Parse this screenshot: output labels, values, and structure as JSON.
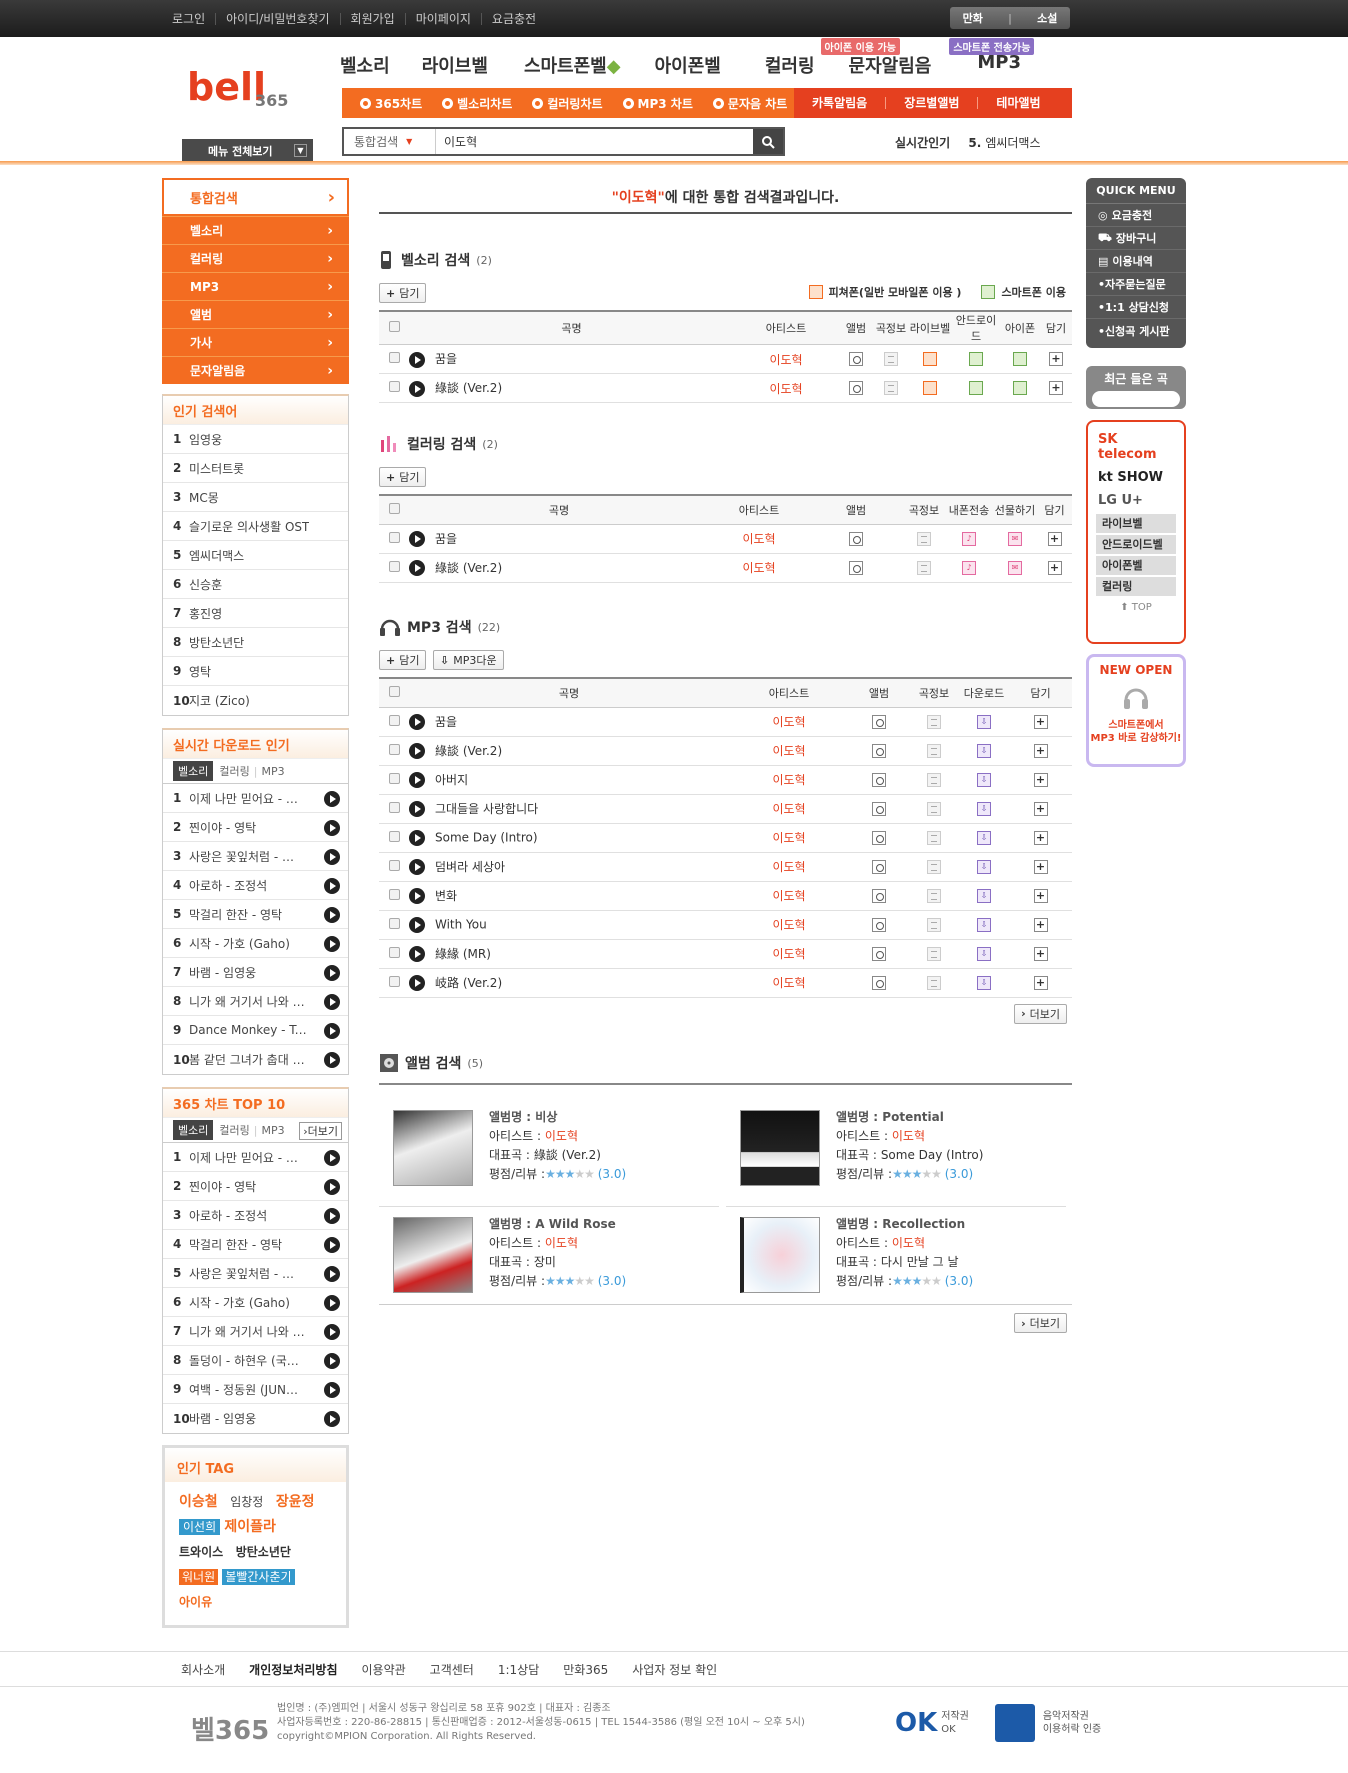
{
  "util": {
    "links": [
      "로그인",
      "아이디/비밀번호찾기",
      "회원가입",
      "마이페이지",
      "요금충전"
    ],
    "toggle": [
      "만화",
      "소설"
    ]
  },
  "nav": {
    "items": [
      "벨소리",
      "라이브벨",
      "스마트폰벨",
      "아이폰벨",
      "컬러링",
      "문자알림음",
      "MP3"
    ],
    "badge_sms": "아이폰 이용 가능",
    "badge_mp3": "스마트폰 전송가능"
  },
  "subnav": {
    "charts": [
      "365차트",
      "벨소리차트",
      "컬러링차트",
      "MP3 차트",
      "문자음 차트"
    ],
    "extra": [
      "카톡알림음",
      "장르별앨범",
      "테마앨범"
    ]
  },
  "menu_all": "메뉴 전체보기",
  "search": {
    "category": "통합검색",
    "query": "이도혁"
  },
  "realtime": {
    "label": "실시간인기",
    "rank": "5.",
    "item": "엠씨더맥스"
  },
  "leftnav": {
    "head": "통합검색",
    "items": [
      "벨소리",
      "컬러링",
      "MP3",
      "앨범",
      "가사",
      "문자알림음"
    ]
  },
  "popular_search": {
    "title": "인기 검색어",
    "items": [
      "임영웅",
      "미스터트롯",
      "MC몽",
      "슬기로운 의사생활 OST",
      "엠씨더맥스",
      "신승훈",
      "홍진영",
      "방탄소년단",
      "영탁",
      "지코 (Zico)"
    ]
  },
  "realtime_dl": {
    "title": "실시간 다운로드 인기",
    "tabs": [
      "벨소리",
      "컬러링",
      "MP3"
    ],
    "items": [
      "이제 나만 믿어요 - …",
      "찐이야 - 영탁",
      "사랑은 꽃잎처럼 - …",
      "아로하 - 조정석",
      "막걸리 한잔 - 영탁",
      "시작 - 가호 (Gaho)",
      "바램 - 임영웅",
      "니가 왜 거기서 나와 …",
      "Dance Monkey - To…",
      "봄 같던 그녀가 춥대 …"
    ]
  },
  "top10": {
    "title": "365 차트 TOP 10",
    "tabs": [
      "벨소리",
      "컬러링",
      "MP3"
    ],
    "more": "더보기",
    "items": [
      "이제 나만 믿어요 - …",
      "찐이야 - 영탁",
      "아로하 - 조정석",
      "막걸리 한잔 - 영탁",
      "사랑은 꽃잎처럼 - …",
      "시작 - 가호 (Gaho)",
      "니가 왜 거기서 나와 …",
      "돌덩이 - 하현우 (국…",
      "여백 - 정동원 (JUN…",
      "바램 - 임영웅"
    ]
  },
  "tags": {
    "title": "인기 TAG",
    "items": [
      "이승철",
      "임창정",
      "장윤정",
      "이선희",
      "제이플라",
      "트와이스",
      "방탄소년단",
      "워너원",
      "볼빨간사춘기",
      "아이유"
    ]
  },
  "result_title": {
    "keyword": "\"이도혁\"",
    "suffix": "에 대한 통합 검색결과입니다."
  },
  "bell": {
    "title": "벨소리 검색",
    "count": "(2)",
    "add": "담기",
    "legend_feature": "피쳐폰(일반 모바일폰 이용 )",
    "legend_smart": "스마트폰 이용",
    "cols": [
      "곡명",
      "아티스트",
      "앨범",
      "곡정보",
      "라이브벨",
      "안드로이드",
      "아이폰",
      "담기"
    ],
    "rows": [
      {
        "title": "꿈을",
        "artist": "이도혁"
      },
      {
        "title": "綠談 (Ver.2)",
        "artist": "이도혁"
      }
    ]
  },
  "coloring": {
    "title": "컬러링 검색",
    "count": "(2)",
    "add": "담기",
    "cols": [
      "곡명",
      "아티스트",
      "앨범",
      "곡정보",
      "내폰전송",
      "선물하기",
      "담기"
    ],
    "rows": [
      {
        "title": "꿈을",
        "artist": "이도혁"
      },
      {
        "title": "綠談 (Ver.2)",
        "artist": "이도혁"
      }
    ]
  },
  "mp3": {
    "title": "MP3 검색",
    "count": "(22)",
    "add": "담기",
    "down": "MP3다운",
    "more": "더보기",
    "cols": [
      "곡명",
      "아티스트",
      "앨범",
      "곡정보",
      "다운로드",
      "담기"
    ],
    "rows": [
      {
        "title": "꿈을",
        "artist": "이도혁"
      },
      {
        "title": "綠談 (Ver.2)",
        "artist": "이도혁"
      },
      {
        "title": "아버지",
        "artist": "이도혁"
      },
      {
        "title": "그대들을 사랑합니다",
        "artist": "이도혁"
      },
      {
        "title": "Some Day (Intro)",
        "artist": "이도혁"
      },
      {
        "title": "덤벼라 세상아",
        "artist": "이도혁"
      },
      {
        "title": "변화",
        "artist": "이도혁"
      },
      {
        "title": "With You",
        "artist": "이도혁"
      },
      {
        "title": "綠緣 (MR)",
        "artist": "이도혁"
      },
      {
        "title": "岐路 (Ver.2)",
        "artist": "이도혁"
      }
    ]
  },
  "album_section": {
    "title": "앨범 검색",
    "count": "(5)",
    "more": "더보기",
    "lbl_name": "앨범명 :",
    "lbl_artist": "아티스트 :",
    "lbl_track": "대표곡 :",
    "lbl_rating": "평점/리뷰 :",
    "items": [
      {
        "name": "비상",
        "artist": "이도혁",
        "track": "綠談 (Ver.2)",
        "stars": 3,
        "score": "(3.0)"
      },
      {
        "name": "Potential",
        "artist": "이도혁",
        "track": "Some Day (Intro)",
        "stars": 3,
        "score": "(3.0)"
      },
      {
        "name": "A Wild Rose",
        "artist": "이도혁",
        "track": "장미",
        "stars": 3,
        "score": "(3.0)"
      },
      {
        "name": "Recollection",
        "artist": "이도혁",
        "track": "다시 만날 그 날",
        "stars": 3,
        "score": "(3.0)"
      }
    ]
  },
  "quick": {
    "title": "QUICK MENU",
    "items": [
      "요금충전",
      "장바구니",
      "이용내역",
      "•자주묻는질문",
      "•1:1 상담신청",
      "•신청곡 게시판"
    ]
  },
  "recent": "최근 들은 곡",
  "telco": {
    "brands": [
      "SK telecom",
      "kt SHOW",
      "LG U+"
    ],
    "links": [
      "라이브벨",
      "안드로이드벨",
      "아이폰벨",
      "컬러링"
    ],
    "top": "TOP"
  },
  "newopen": {
    "title": "NEW OPEN",
    "line1": "스마트폰에서",
    "line2": "MP3 바로 감상하기!"
  },
  "footnav": [
    "회사소개",
    "개인정보처리방침",
    "이용약관",
    "고객센터",
    "1:1상담",
    "만화365",
    "사업자 정보 확인"
  ],
  "footer": {
    "logo": "벨365",
    "line1": "법인명 : (주)엠피언  |  서울시 성동구 왕십리로 58 포휴 902호  |  대표자 : 김종조",
    "line2": "사업자등록번호 : 220-86-28815  |  통신판매업증 : 2012-서울성동-0615  |  TEL 1544-3586 (평일 오전 10시 ~ 오후 5시)",
    "line3": "copyright©MPION Corporation. All Rights Reserved.",
    "cert1a": "저작권",
    "cert1b": "OK",
    "cert2a": "음악저작권",
    "cert2b": "이용허락 인증"
  },
  "colors": {
    "accent": "#f36c21",
    "accent_dark": "#e5401f",
    "dark": "#444444"
  }
}
